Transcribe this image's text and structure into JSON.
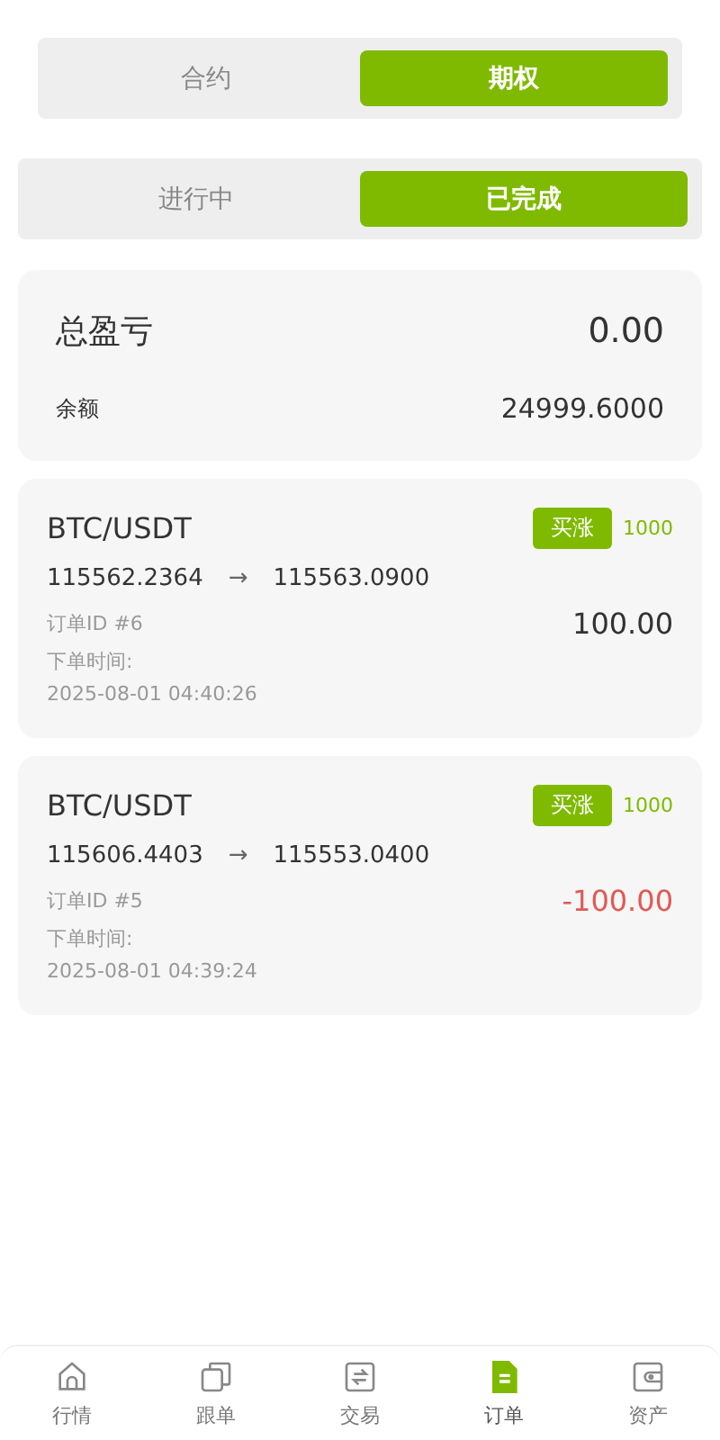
{
  "market_tabs": [
    {
      "label": "合约",
      "selected": false
    },
    {
      "label": "期权",
      "selected": true
    }
  ],
  "status_tabs": [
    {
      "label": "进行中",
      "selected": false
    },
    {
      "label": "已完成",
      "selected": true
    }
  ],
  "summary": {
    "title": "总盈亏",
    "total": "0.00",
    "balance_label": "余额",
    "balance": "24999.6000"
  },
  "orders": [
    {
      "pair": "BTC/USDT",
      "direction": "买涨",
      "quantity": "1000",
      "open_price": "115562.2364",
      "arrow": "→",
      "close_price": "115563.0900",
      "order_id": "订单ID #6",
      "time_label": "下单时间:",
      "time": "2025-08-01 04:40:26",
      "amount": "100.00",
      "color": "#333333"
    },
    {
      "pair": "BTC/USDT",
      "direction": "买涨",
      "quantity": "1000",
      "open_price": "115606.4403",
      "arrow": "→",
      "close_price": "115553.0400",
      "order_id": "订单ID #5",
      "time_label": "下单时间:",
      "time": "2025-08-01 04:39:24",
      "amount": "-100.00",
      "color": "#e05a55"
    }
  ],
  "bottom_nav": [
    {
      "label": "行情",
      "kind": "home",
      "selected": false
    },
    {
      "label": "跟单",
      "kind": "copy",
      "selected": false
    },
    {
      "label": "交易",
      "kind": "swap",
      "selected": false
    },
    {
      "label": "订单",
      "kind": "order",
      "selected": true
    },
    {
      "label": "资产",
      "kind": "wallet",
      "selected": false
    }
  ]
}
